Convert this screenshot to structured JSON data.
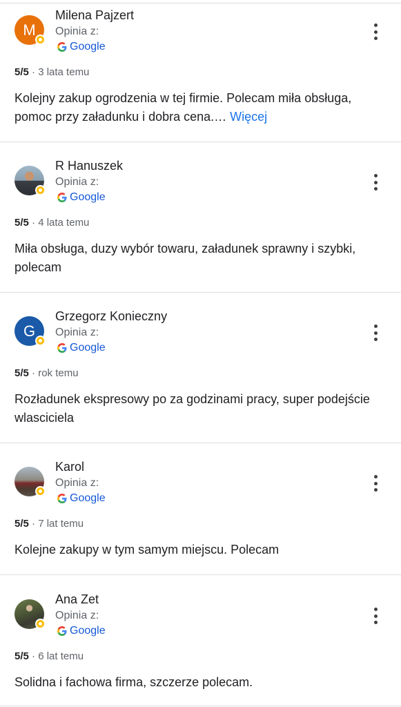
{
  "reviews": [
    {
      "name": "Milena Pajzert",
      "avatar_letter": "M",
      "avatar_color": "#e8710a",
      "source_label": "Opinia z:",
      "source_name": "Google",
      "score": "5/5",
      "time": "· 3 lata temu",
      "text": "Kolejny zakup ogrodzenia w tej firmie. Polecam miła obsługa, pomoc przy załadunku i dobra cena.… ",
      "more_link": "Więcej"
    },
    {
      "name": "R Hanuszek",
      "avatar_letter": "",
      "source_label": "Opinia z:",
      "source_name": "Google",
      "score": "5/5",
      "time": "· 4 lata temu",
      "text": "Miła obsługa, duzy wybór towaru, załadunek sprawny i szybki, polecam"
    },
    {
      "name": "Grzegorz Konieczny",
      "avatar_letter": "G",
      "avatar_color": "#1a5aa8",
      "source_label": "Opinia z:",
      "source_name": "Google",
      "score": "5/5",
      "time": "· rok temu",
      "text": "Rozładunek ekspresowy po za godzinami pracy, super podejście wlasciciela"
    },
    {
      "name": "Karol",
      "avatar_letter": "",
      "source_label": "Opinia z:",
      "source_name": "Google",
      "score": "5/5",
      "time": "· 7 lat temu",
      "text": "Kolejne zakupy w tym samym miejscu. Polecam"
    },
    {
      "name": "Ana Zet",
      "avatar_letter": "",
      "source_label": "Opinia z:",
      "source_name": "Google",
      "score": "5/5",
      "time": "· 6 lat temu",
      "text": "Solidna i fachowa firma, szczerze polecam."
    }
  ],
  "icons": {
    "menu": "more-vert-icon",
    "source": "google-g-icon",
    "badge": "local-guide-badge-icon"
  },
  "colors": {
    "link": "#1a73e8",
    "badge": "#fbbc04",
    "divider": "#dadce0"
  }
}
